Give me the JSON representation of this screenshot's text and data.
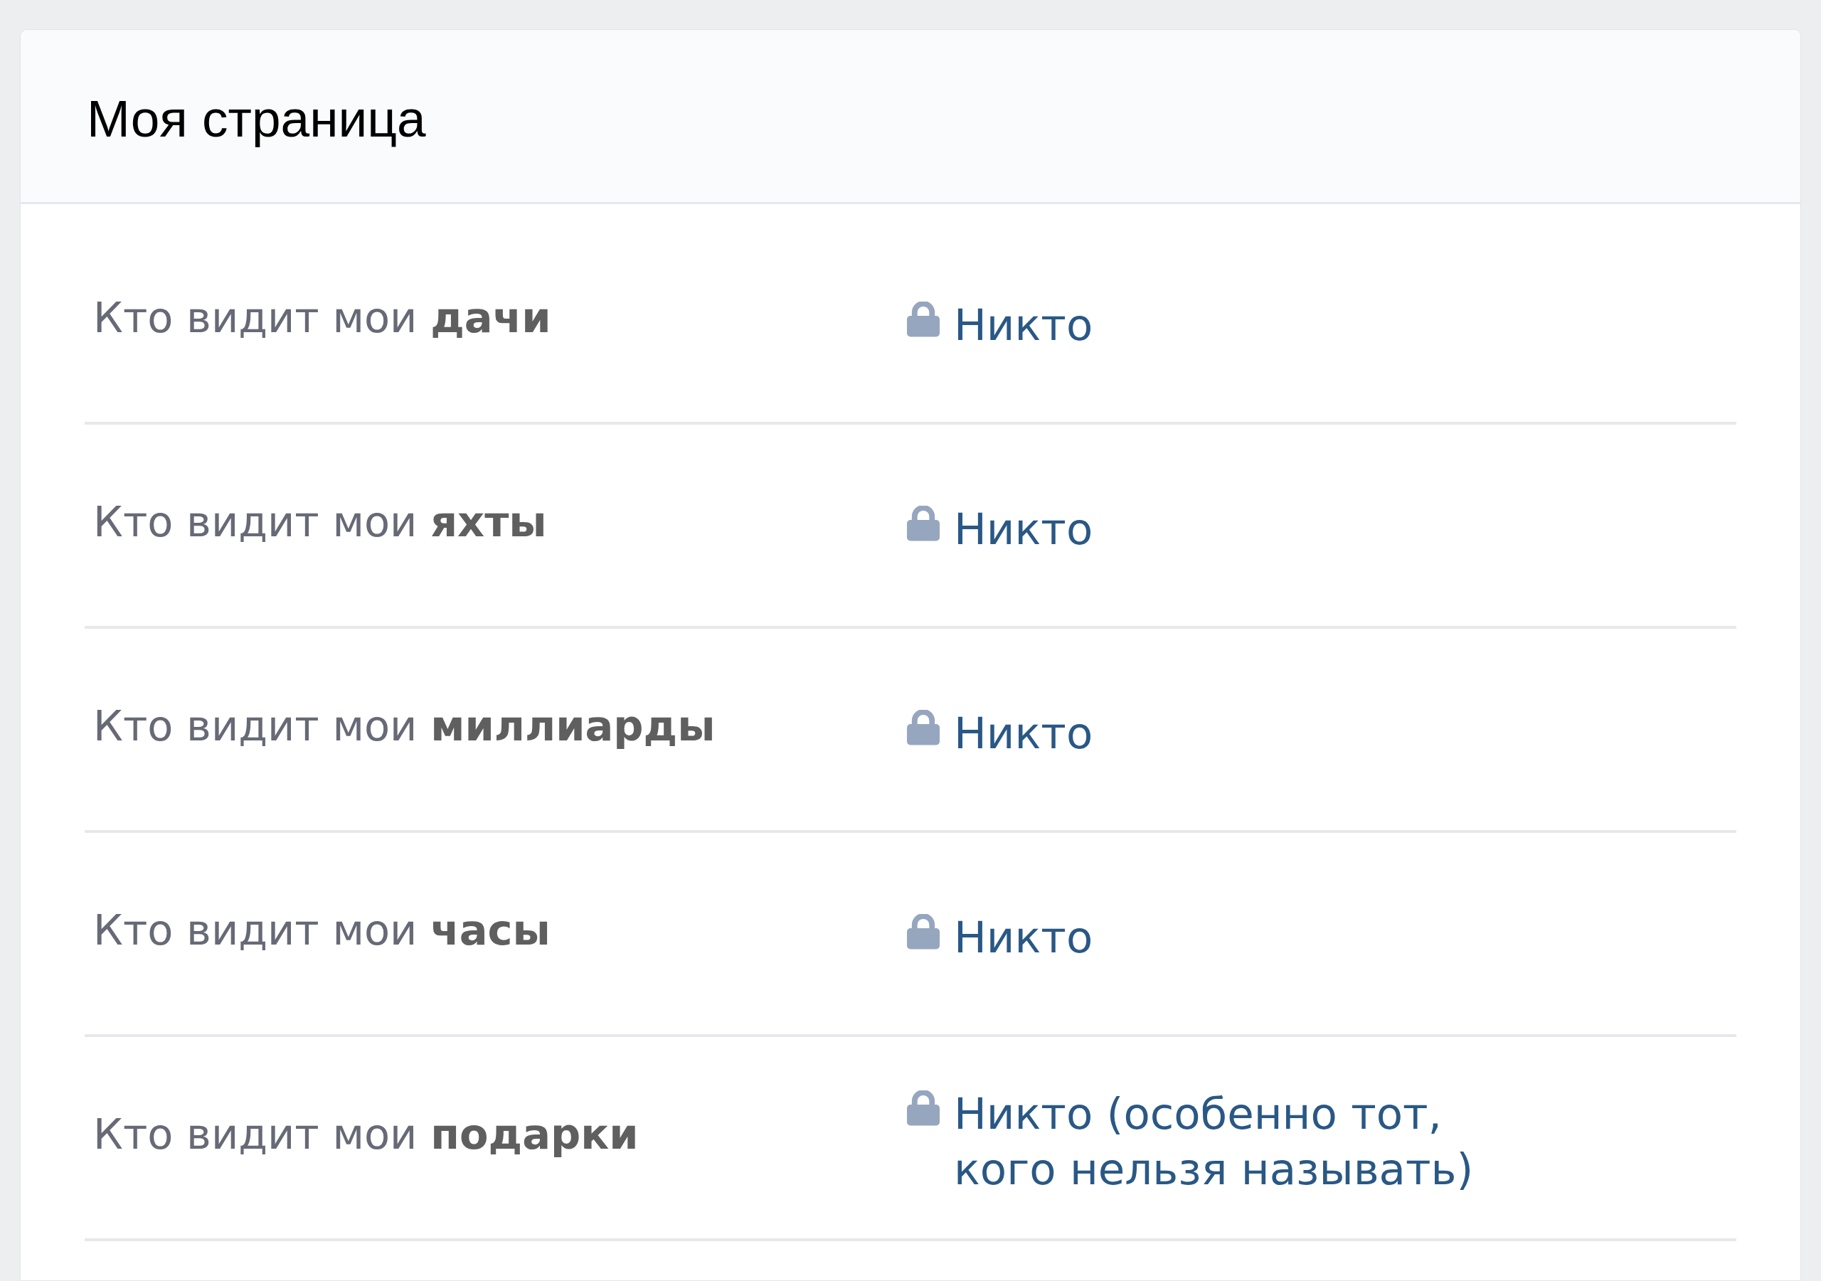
{
  "header": {
    "title": "Моя страница"
  },
  "settings": [
    {
      "label": "Кто видит мои **дачи**",
      "value": "Никто"
    },
    {
      "label": "Кто видит мои **яхты**",
      "value": "Никто"
    },
    {
      "label": "Кто видит мои **миллиарды**",
      "value": "Никто"
    },
    {
      "label": "Кто видит мои **часы**",
      "value": "Никто"
    },
    {
      "label": "Кто видит мои **подарки**",
      "value": "Никто (особенно тот, кого нельзя называть)"
    }
  ]
}
